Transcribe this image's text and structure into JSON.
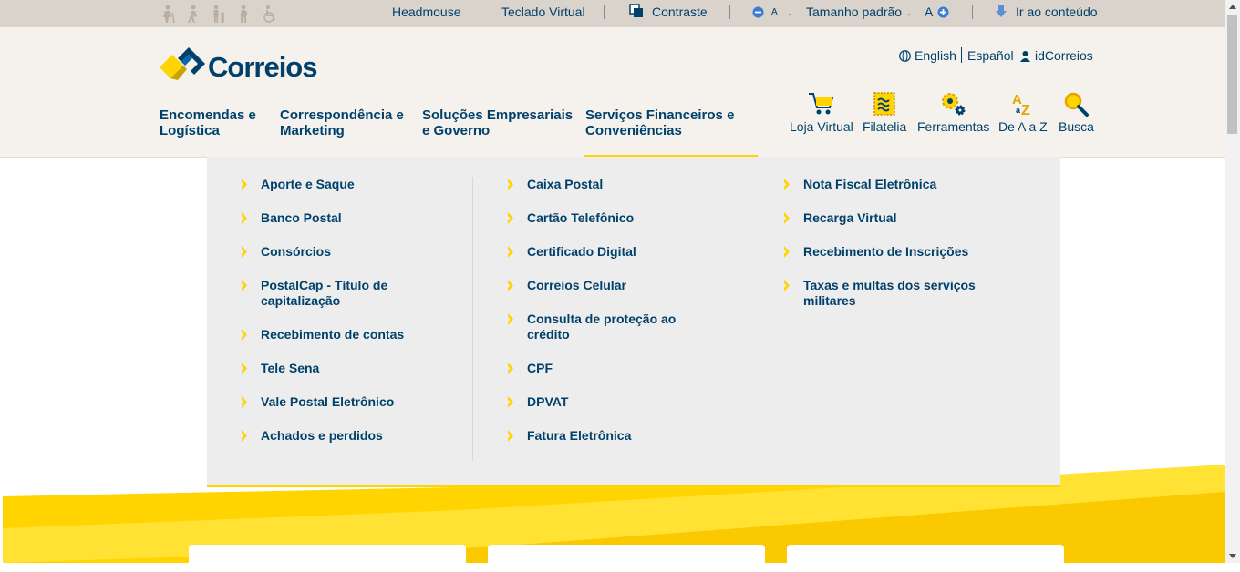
{
  "accessibility_bar": {
    "items": [
      {
        "label": "Headmouse"
      },
      {
        "label": "Teclado Virtual"
      },
      {
        "label": "Contraste"
      },
      {
        "label": "Tamanho padrão"
      },
      {
        "label": "Ir ao conteúdo"
      }
    ],
    "font_minus_label": "A",
    "font_plus_label": "A",
    "dot_separator": "."
  },
  "header": {
    "logo_text": "Correios",
    "languages": [
      {
        "label": "English"
      },
      {
        "label": "Español"
      },
      {
        "label": "idCorreios"
      }
    ],
    "nav": [
      {
        "label": "Encomendas e Logística"
      },
      {
        "label": "Correspondência e Marketing"
      },
      {
        "label": "Soluções Empresariais e Governo"
      },
      {
        "label": "Serviços Financeiros e Conveniências",
        "active": true
      }
    ],
    "tools": [
      {
        "label": "Loja Virtual",
        "icon": "cart-icon"
      },
      {
        "label": "Filatelia",
        "icon": "stamp-icon"
      },
      {
        "label": "Ferramentas",
        "icon": "gears-icon"
      },
      {
        "label": "De A a Z",
        "icon": "a-to-z-icon"
      },
      {
        "label": "Busca",
        "icon": "search-icon"
      }
    ]
  },
  "dropdown": {
    "columns": [
      [
        "Aporte e Saque",
        "Banco Postal",
        "Consórcios",
        "PostalCap - Título de capitalização",
        "Recebimento de contas",
        "Tele Sena",
        "Vale Postal Eletrônico",
        "Achados e perdidos"
      ],
      [
        "Caixa Postal",
        "Cartão Telefônico",
        "Certificado Digital",
        "Correios Celular",
        "Consulta de proteção ao crédito",
        "CPF",
        "DPVAT",
        "Fatura Eletrônica"
      ],
      [
        "Nota Fiscal Eletrônica",
        "Recarga Virtual",
        "Recebimento de Inscrições",
        "Taxas e multas dos serviços militares"
      ]
    ]
  },
  "colors": {
    "brand_blue": "#00416b",
    "brand_yellow": "#ffd400",
    "topbar_bg": "#d9d3cc",
    "header_bg": "#f5f2ee",
    "dropdown_bg": "#ededed"
  }
}
